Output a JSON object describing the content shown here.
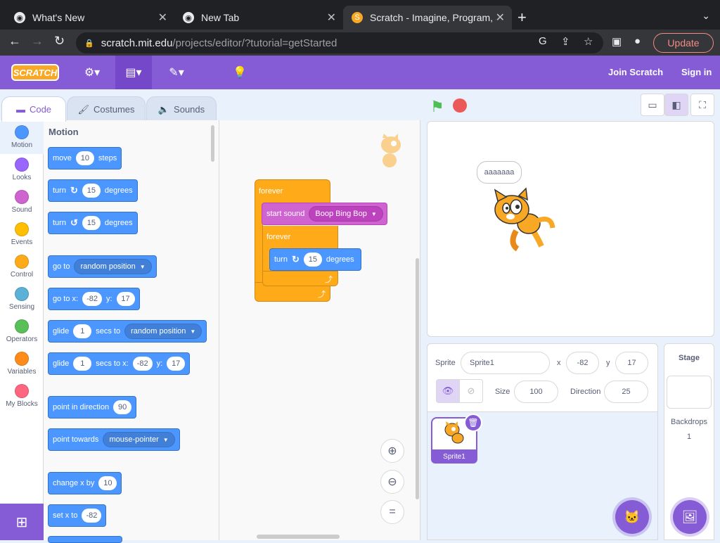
{
  "browser": {
    "tabs": [
      {
        "title": "What's New",
        "active": false
      },
      {
        "title": "New Tab",
        "active": false
      },
      {
        "title": "Scratch - Imagine, Program, Sh",
        "active": true
      }
    ],
    "url_domain": "scratch.mit.edu",
    "url_path": "/projects/editor/?tutorial=getStarted",
    "update_label": "Update"
  },
  "menubar": {
    "logo": "SCRATCH",
    "join_label": "Join Scratch",
    "signin_label": "Sign in"
  },
  "editor_tabs": {
    "code": "Code",
    "costumes": "Costumes",
    "sounds": "Sounds"
  },
  "categories": [
    {
      "label": "Motion",
      "color": "#4c97ff"
    },
    {
      "label": "Looks",
      "color": "#9966ff"
    },
    {
      "label": "Sound",
      "color": "#cf63cf"
    },
    {
      "label": "Events",
      "color": "#ffbf00"
    },
    {
      "label": "Control",
      "color": "#ffab19"
    },
    {
      "label": "Sensing",
      "color": "#5cb1d6"
    },
    {
      "label": "Operators",
      "color": "#59c059"
    },
    {
      "label": "Variables",
      "color": "#ff8c1a"
    },
    {
      "label": "My Blocks",
      "color": "#ff6680"
    }
  ],
  "palette": {
    "section_title": "Motion",
    "move": {
      "pre": "move",
      "value": "10",
      "post": "steps"
    },
    "turn_right": {
      "pre": "turn",
      "value": "15",
      "post": "degrees"
    },
    "turn_left": {
      "pre": "turn",
      "value": "15",
      "post": "degrees"
    },
    "goto": {
      "pre": "go to",
      "option": "random position"
    },
    "goto_xy": {
      "pre": "go to x:",
      "x": "-82",
      "ylabel": "y:",
      "y": "17"
    },
    "glide_to": {
      "pre": "glide",
      "secs": "1",
      "mid": "secs to",
      "option": "random position"
    },
    "glide_xy": {
      "pre": "glide",
      "secs": "1",
      "mid": "secs to x:",
      "x": "-82",
      "ylabel": "y:",
      "y": "17"
    },
    "point_dir": {
      "pre": "point in direction",
      "value": "90"
    },
    "point_towards": {
      "pre": "point towards",
      "option": "mouse-pointer"
    },
    "change_x": {
      "pre": "change x by",
      "value": "10"
    },
    "set_x": {
      "pre": "set x to",
      "value": "-82"
    }
  },
  "script": {
    "forever_outer": "forever",
    "start_sound": {
      "pre": "start sound",
      "option": "Boop Bing Bop"
    },
    "forever_inner": "forever",
    "turn": {
      "pre": "turn",
      "value": "15",
      "post": "degrees"
    }
  },
  "stage": {
    "speech": "aaaaaaa"
  },
  "sprite_info": {
    "sprite_label": "Sprite",
    "sprite_name": "Sprite1",
    "x_label": "x",
    "x": "-82",
    "y_label": "y",
    "y": "17",
    "size_label": "Size",
    "size": "100",
    "direction_label": "Direction",
    "direction": "25"
  },
  "sprites": [
    {
      "name": "Sprite1"
    }
  ],
  "stage_pane": {
    "title": "Stage",
    "backdrops_label": "Backdrops",
    "backdrops_count": "1"
  }
}
